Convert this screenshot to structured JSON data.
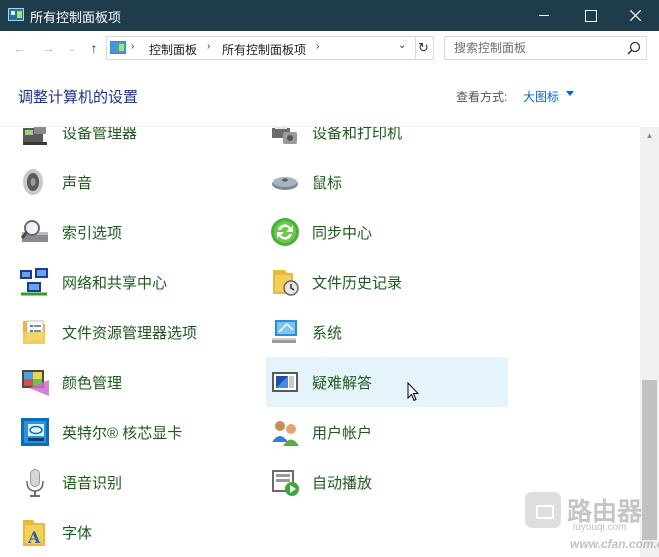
{
  "window": {
    "title": "所有控制面板项"
  },
  "nav": {
    "breadcrumb": [
      "控制面板",
      "所有控制面板项"
    ],
    "search_placeholder": "搜索控制面板"
  },
  "header": {
    "title": "调整计算机的设置",
    "view_by_label": "查看方式:",
    "view_by_value": "大图标"
  },
  "items": {
    "device_manager": "设备管理器",
    "devices_printers": "设备和打印机",
    "sound": "声音",
    "mouse": "鼠标",
    "indexing": "索引选项",
    "sync_center": "同步中心",
    "network_sharing": "网络和共享中心",
    "file_history": "文件历史记录",
    "explorer_options": "文件资源管理器选项",
    "system": "系统",
    "color_management": "颜色管理",
    "troubleshooting": "疑难解答",
    "intel_graphics": "英特尔® 核芯显卡",
    "user_accounts": "用户帐户",
    "speech_recognition": "语音识别",
    "autoplay": "自动播放",
    "fonts": "字体"
  },
  "watermark": {
    "brand": "路由器",
    "sub": "luyouqi.com",
    "url": "www.cfan.com.cn"
  },
  "colors": {
    "titlebar_bg": "#1f3c4a",
    "item_text": "#1e5a1e",
    "heading": "#1e3287",
    "link": "#0066cc",
    "hover_bg": "#e5f3fb"
  }
}
